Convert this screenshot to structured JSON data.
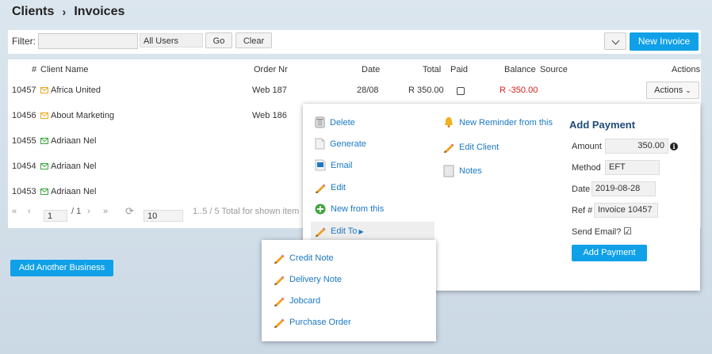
{
  "breadcrumb": {
    "parent": "Clients",
    "separator": "›",
    "current": "Invoices"
  },
  "filter": {
    "label": "Filter:",
    "input_value": "",
    "users_select": "All Users",
    "go_label": "Go",
    "clear_label": "Clear",
    "new_invoice_label": "New Invoice"
  },
  "table": {
    "headers": {
      "num": "#",
      "client": "Client Name",
      "order": "Order Nr",
      "date": "Date",
      "total": "Total",
      "paid": "Paid",
      "balance": "Balance",
      "source": "Source",
      "actions": "Actions"
    },
    "rows": [
      {
        "num": "10457",
        "client": "Africa United",
        "order": "Web 187",
        "date": "28/08",
        "total": "R 350.00",
        "balance": "R -350.00",
        "icon_color": "#e8a91c"
      },
      {
        "num": "10456",
        "client": "About Marketing",
        "order": "Web 186",
        "date": "",
        "total": "",
        "balance": "",
        "icon_color": "#e8a91c"
      },
      {
        "num": "10455",
        "client": "Adriaan Nel",
        "order": "",
        "date": "",
        "total": "",
        "balance": "",
        "icon_color": "#3aa63a"
      },
      {
        "num": "10454",
        "client": "Adriaan Nel",
        "order": "",
        "date": "",
        "total": "",
        "balance": "",
        "icon_color": "#3aa63a"
      },
      {
        "num": "10453",
        "client": "Adriaan Nel",
        "order": "",
        "date": "",
        "total": "",
        "balance": "",
        "icon_color": "#3aa63a"
      }
    ],
    "actions_button": "Actions"
  },
  "pager": {
    "page": "1",
    "of": "/ 1",
    "page_size": "10",
    "summary": "1..5 / 5  Total for shown item"
  },
  "add_business_label": "Add Another Business",
  "actions_menu": {
    "col1": [
      "Delete",
      "Generate",
      "Email",
      "Edit",
      "New from this",
      "Edit To"
    ],
    "col2": [
      "New Reminder from this",
      "Edit Client",
      "Notes"
    ]
  },
  "add_payment": {
    "title": "Add Payment",
    "amount_label": "Amount",
    "amount_value": "350.00",
    "method_label": "Method",
    "method_value": "EFT",
    "date_label": "Date",
    "date_value": "2019-08-28",
    "ref_label": "Ref #",
    "ref_value": "Invoice 10457",
    "send_email_label": "Send Email?",
    "send_email_checked": true,
    "button_label": "Add Payment"
  },
  "edit_to_menu": [
    "Credit Note",
    "Delivery Note",
    "Jobcard",
    "Purchase Order"
  ],
  "colors": {
    "accent": "#0fa0e8",
    "link": "#1a78c2",
    "negative": "#d0211c",
    "title": "#1e4a78"
  }
}
